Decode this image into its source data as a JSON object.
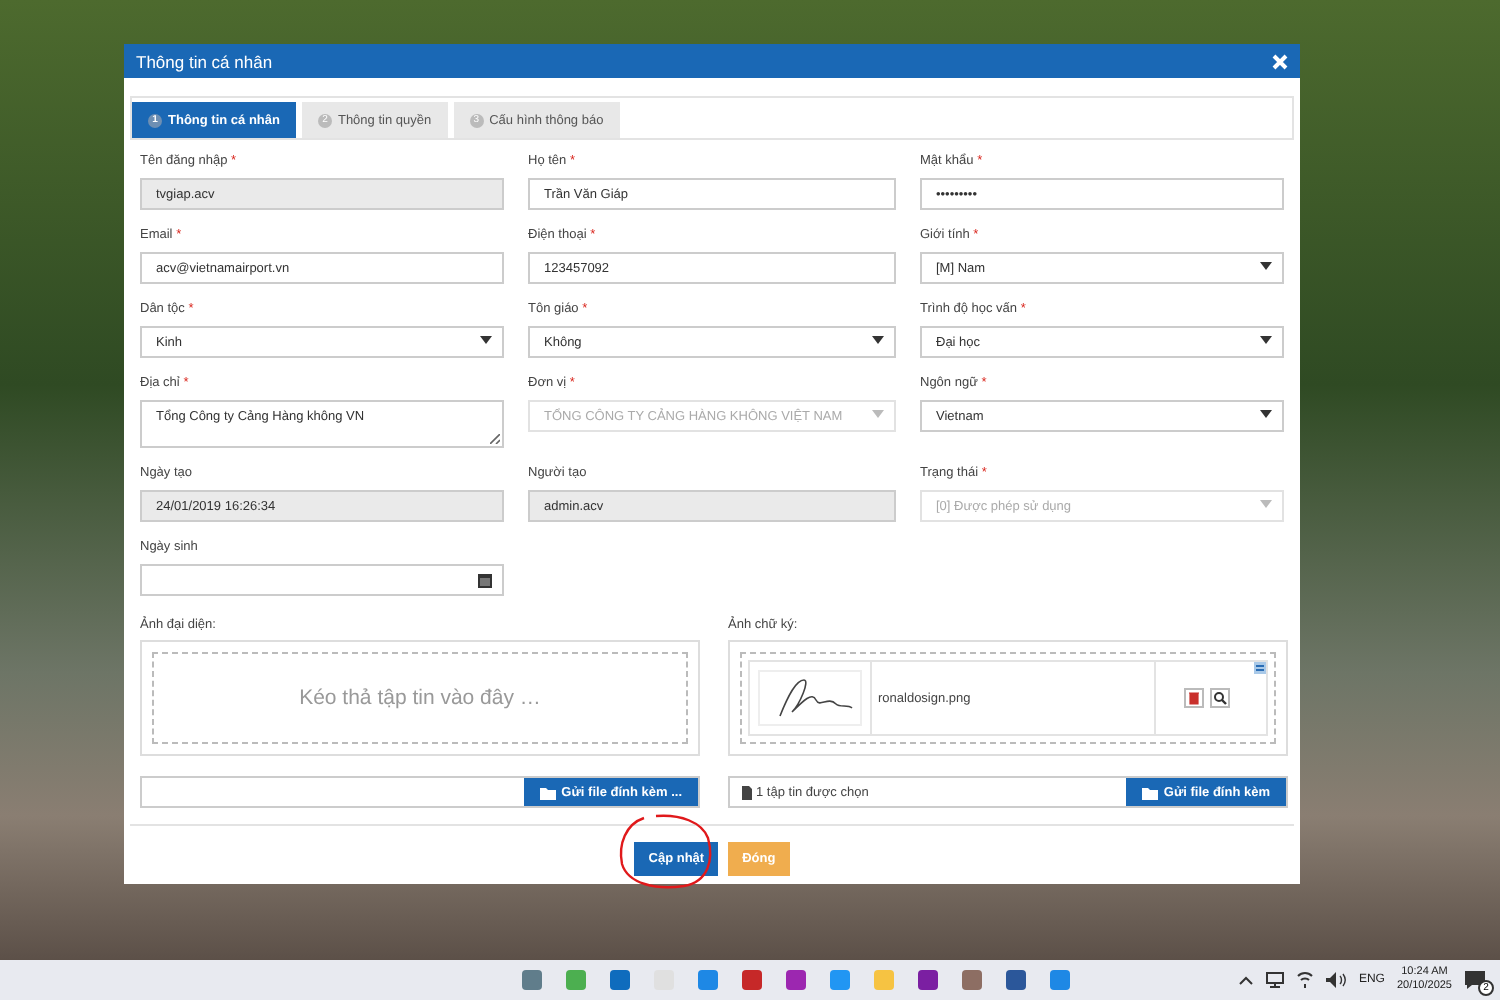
{
  "dialog": {
    "title": "Thông tin cá nhân",
    "tabs": [
      {
        "number": "1",
        "label": "Thông tin cá nhân",
        "selected": true
      },
      {
        "number": "2",
        "label": "Thông tin quyền",
        "selected": false
      },
      {
        "number": "3",
        "label": "Cấu hình thông báo",
        "selected": false
      }
    ],
    "fields": [
      {
        "label": "Tên đăng nhập",
        "required_mark": "*",
        "kind": "text",
        "value": "tvgiap.acv",
        "readonly": true,
        "disabled": false
      },
      {
        "label": "Họ tên",
        "required_mark": "*",
        "kind": "text",
        "value": "Trần Văn Giáp",
        "readonly": false,
        "disabled": false
      },
      {
        "label": "Mật khẩu",
        "required_mark": "*",
        "kind": "text",
        "value": "•••••••••",
        "readonly": false,
        "disabled": false
      },
      {
        "label": "Email",
        "required_mark": "*",
        "kind": "text",
        "value": "acv@vietnamairport.vn",
        "readonly": false,
        "disabled": false
      },
      {
        "label": "Điện thoại",
        "required_mark": "*",
        "kind": "text",
        "value": "123457092",
        "readonly": false,
        "disabled": false
      },
      {
        "label": "Giới tính",
        "required_mark": "*",
        "kind": "select",
        "value": "[M] Nam",
        "readonly": false,
        "disabled": false
      },
      {
        "label": "Dân tộc",
        "required_mark": "*",
        "kind": "select",
        "value": "Kinh",
        "readonly": false,
        "disabled": false
      },
      {
        "label": "Tôn giáo",
        "required_mark": "*",
        "kind": "select",
        "value": "Không",
        "readonly": false,
        "disabled": false
      },
      {
        "label": "Trình độ học vấn",
        "required_mark": "*",
        "kind": "select",
        "value": "Đại học",
        "readonly": false,
        "disabled": false
      },
      {
        "label": "Địa chỉ",
        "required_mark": "*",
        "kind": "textarea",
        "value": "Tổng Công ty Cảng Hàng không VN",
        "readonly": false,
        "disabled": false
      },
      {
        "label": "Đơn vị",
        "required_mark": "*",
        "kind": "select",
        "value": "TỔNG CÔNG TY CẢNG HÀNG KHÔNG VIỆT NAM",
        "readonly": false,
        "disabled": true
      },
      {
        "label": "Ngôn ngữ",
        "required_mark": "*",
        "kind": "select",
        "value": "Vietnam",
        "readonly": false,
        "disabled": false
      },
      {
        "label": "Ngày tạo",
        "kind": "text",
        "value": "24/01/2019 16:26:34",
        "readonly": true,
        "disabled": false
      },
      {
        "label": "Người tạo",
        "kind": "text",
        "value": "admin.acv",
        "readonly": true,
        "disabled": false
      },
      {
        "label": "Trạng thái",
        "required_mark": "*",
        "kind": "select",
        "value": "[0] Được phép sử dụng",
        "readonly": false,
        "disabled": true
      },
      {
        "label": "Ngày sinh",
        "kind": "date",
        "readonly": false,
        "disabled": false
      }
    ],
    "uploads": [
      {
        "label": "Ảnh đại diện:",
        "kind": "dropzone",
        "drop_text": "Kéo thả tập tin vào đây …",
        "button": "Gửi file đính kèm ..."
      },
      {
        "label": "Ảnh chữ ký:",
        "kind": "preview",
        "file_name": "ronaldosign.png",
        "file_status": "1 tập tin được chọn",
        "button": "Gửi file đính kèm"
      }
    ],
    "buttons": [
      {
        "label": "Cập nhật",
        "kind": "primary",
        "annotation": {
          "kind": "circle"
        }
      },
      {
        "label": "Đóng",
        "kind": "warning"
      }
    ]
  },
  "taskbar": {
    "language": "ENG",
    "time": "10:24 AM",
    "date": "20/10/2025",
    "notification_count": "2"
  }
}
